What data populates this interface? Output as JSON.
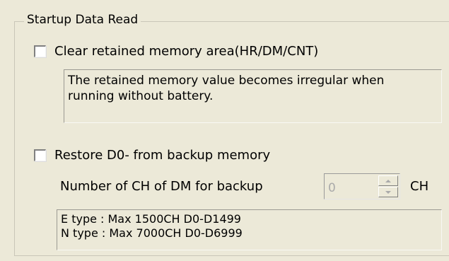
{
  "group": {
    "title": "Startup Data Read"
  },
  "clear_retained": {
    "label": "Clear retained memory area(HR/DM/CNT)",
    "checked": false,
    "note": "The retained memory value becomes irregular when\nrunning without battery."
  },
  "restore": {
    "label": "Restore D0- from backup memory",
    "checked": false,
    "count_label": "Number of CH of DM for backup",
    "count_value": "0",
    "unit": "CH",
    "note": "E type : Max 1500CH   D0-D1499\nN type : Max 7000CH   D0-D6999"
  },
  "icons": {
    "spin_up": "spin-up-arrow-icon",
    "spin_down": "spin-down-arrow-icon"
  }
}
